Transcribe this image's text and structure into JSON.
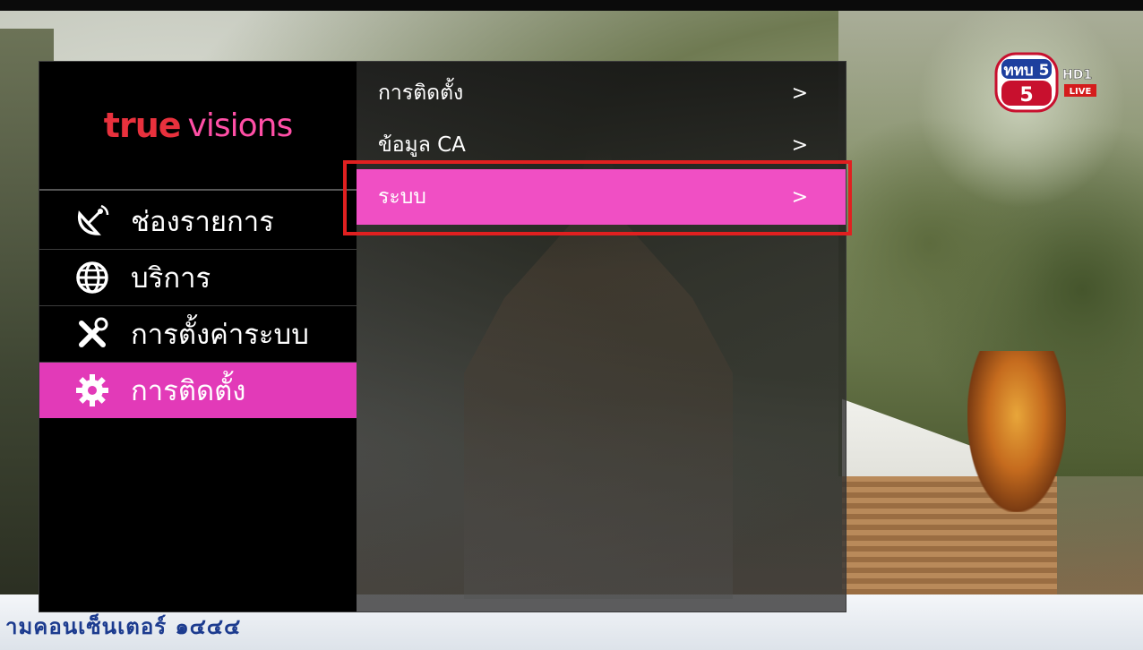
{
  "brand": {
    "true": "true",
    "visions": "visions"
  },
  "channel_logo": {
    "name": "ททบ 5",
    "badge": "HD1",
    "live": "LIVE"
  },
  "nav": [
    {
      "label": "ช่องรายการ",
      "icon": "satellite-dish-icon",
      "active": false
    },
    {
      "label": "บริการ",
      "icon": "globe-icon",
      "active": false
    },
    {
      "label": "การตั้งค่าระบบ",
      "icon": "tools-icon",
      "active": false
    },
    {
      "label": "การติดตั้ง",
      "icon": "gear-icon",
      "active": true
    }
  ],
  "submenu": [
    {
      "label": "การติดตั้ง",
      "arrow": ">"
    },
    {
      "label": "ข้อมูล CA",
      "arrow": ">"
    },
    {
      "label": "ระบบ",
      "arrow": ">",
      "active": true
    }
  ],
  "ticker": {
    "text": "ามคอนเซ็นเตอร์ ๑๔๔๔"
  },
  "colors": {
    "accent": "#e23ab8",
    "accent_sub": "#f04fc4",
    "highlight": "#e02020",
    "brand_true": "#e8313d",
    "brand_visions": "#ff4fa6"
  }
}
